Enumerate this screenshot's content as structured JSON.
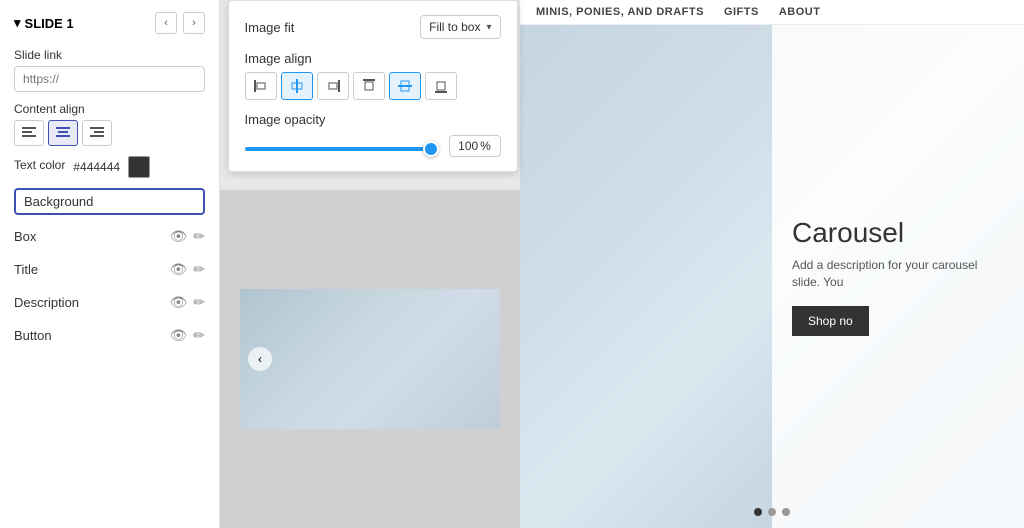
{
  "slide": {
    "title": "SLIDE 1",
    "triangle": "▾"
  },
  "nav": {
    "prev": "‹",
    "next": "›"
  },
  "slide_link": {
    "label": "Slide link",
    "placeholder": "https://"
  },
  "content_align": {
    "label": "Content align",
    "buttons": [
      "≡",
      "≡",
      "≡"
    ],
    "active_index": 1
  },
  "text_color": {
    "label": "Text color",
    "hex": "#444444"
  },
  "background": {
    "label": "Background"
  },
  "layers": [
    {
      "name": "Box"
    },
    {
      "name": "Title"
    },
    {
      "name": "Description"
    },
    {
      "name": "Button"
    }
  ],
  "popup": {
    "image_fit": {
      "label": "Image fit",
      "value": "Fill to box"
    },
    "image_align": {
      "label": "Image align",
      "buttons": [
        {
          "icon": "⬛",
          "label": "align-left",
          "active": false
        },
        {
          "icon": "⬛",
          "label": "align-center",
          "active": true
        },
        {
          "icon": "⬛",
          "label": "align-right",
          "active": false
        },
        {
          "icon": "⬆",
          "label": "align-top",
          "active": false
        },
        {
          "icon": "⬛",
          "label": "align-middle",
          "active": true
        },
        {
          "icon": "⬇",
          "label": "align-bottom",
          "active": false
        }
      ]
    },
    "image_opacity": {
      "label": "Image opacity",
      "value": 100,
      "unit": "%"
    }
  },
  "right_nav": {
    "items": [
      "MINIS, PONIES, AND DRAFTS",
      "GIFTS",
      "ABOUT"
    ]
  },
  "carousel": {
    "title": "Carousel",
    "desc": "Add a description for your carousel slide. You",
    "shop_btn": "Shop no"
  },
  "dots": [
    {
      "active": true
    },
    {
      "active": false
    },
    {
      "active": false
    }
  ],
  "icons": {
    "eye": "👁",
    "edit": "✏",
    "chevron_down": "▾",
    "left_arrow": "‹",
    "right_arrow": "›"
  }
}
